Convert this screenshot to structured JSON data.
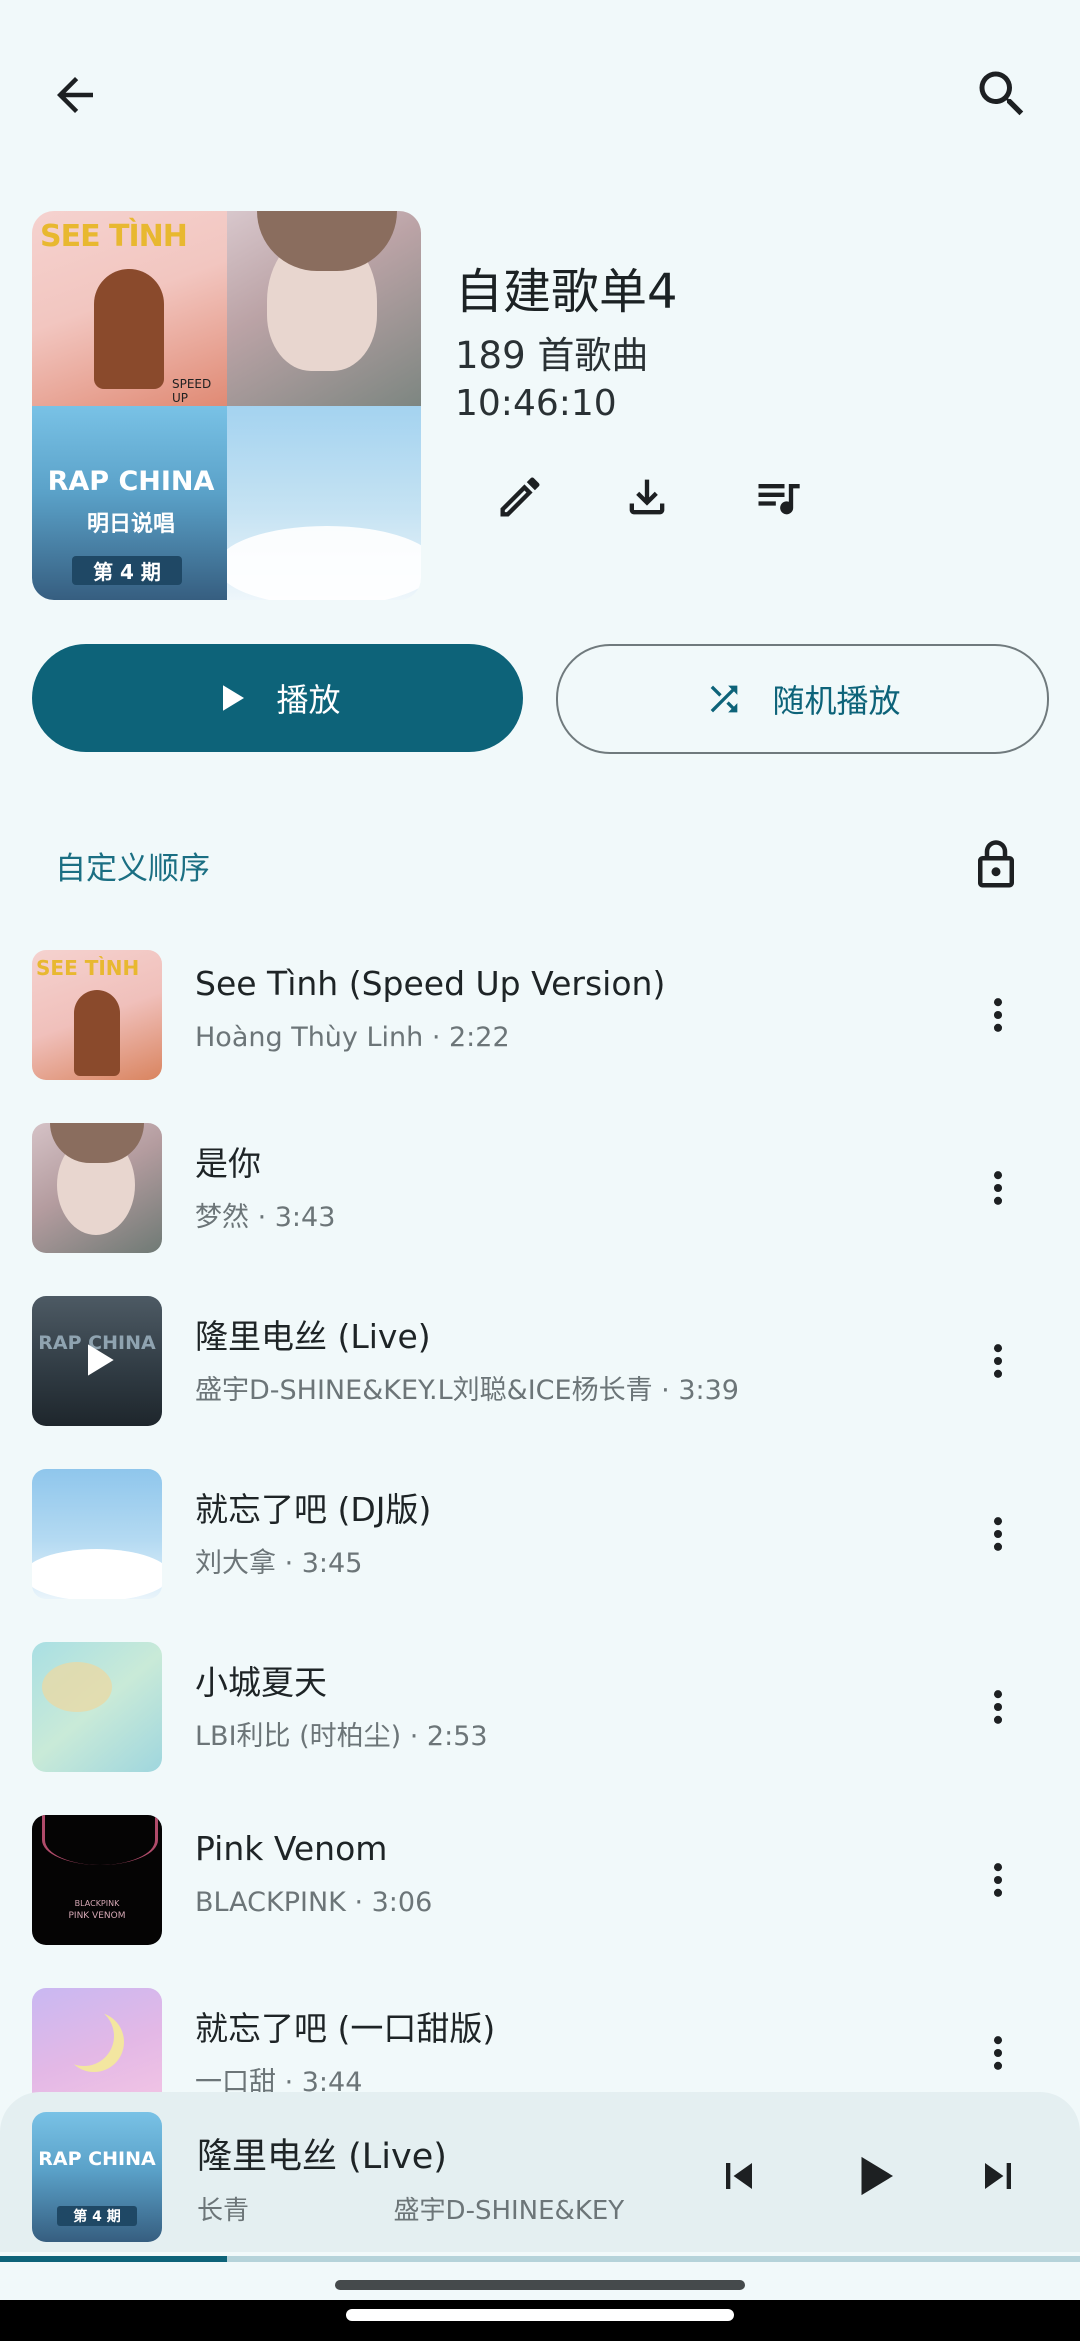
{
  "header": {
    "back_icon": "arrow-left-icon",
    "search_icon": "search-icon"
  },
  "playlist": {
    "title": "自建歌单4",
    "count": "189 首歌曲",
    "duration": "10:46:10",
    "cover_text": {
      "tile1_top": "SEE TÌNH",
      "tile1_badge": "SPEED UP",
      "tile3_brand": "RAP CHINA",
      "tile3_sub": "明日说唱",
      "tile3_episode": "第 4 期"
    }
  },
  "actions": {
    "play_label": "播放",
    "shuffle_label": "随机播放",
    "icons": [
      "edit-icon",
      "download-icon",
      "queue-music-icon",
      "play-icon",
      "shuffle-icon"
    ]
  },
  "sort": {
    "label": "自定义顺序",
    "lock_icon": "lock-icon"
  },
  "songs": [
    {
      "title": "See Tình (Speed Up Version)",
      "meta": "Hoàng Thùy Linh  ·  2:22"
    },
    {
      "title": "是你",
      "meta": "梦然  ·  3:43"
    },
    {
      "title": "隆里电丝 (Live)",
      "meta": "盛宇D-SHINE&KEY.L刘聪&ICE杨长青  ·  3:39"
    },
    {
      "title": "就忘了吧 (DJ版)",
      "meta": "刘大拿  ·  3:45"
    },
    {
      "title": "小城夏天",
      "meta": "LBI利比 (时柏尘)  ·  2:53"
    },
    {
      "title": "Pink Venom",
      "meta": "BLACKPINK  ·  3:06"
    },
    {
      "title": "就忘了吧 (一口甜版)",
      "meta": "一口甜  ·  3:44"
    }
  ],
  "thumb_text": {
    "pink_venom_band": "BLACKPINK",
    "pink_venom_title": "PINK VENOM"
  },
  "now_playing": {
    "title": "隆里电丝 (Live)",
    "artist_left": "长青",
    "artist_right": "盛宇D-SHINE&KEY",
    "progress": 0.21,
    "thumb_brand": "RAP CHINA",
    "thumb_episode": "第 4 期"
  },
  "colors": {
    "accent": "#0d6379",
    "background": "#f1f9fa"
  }
}
